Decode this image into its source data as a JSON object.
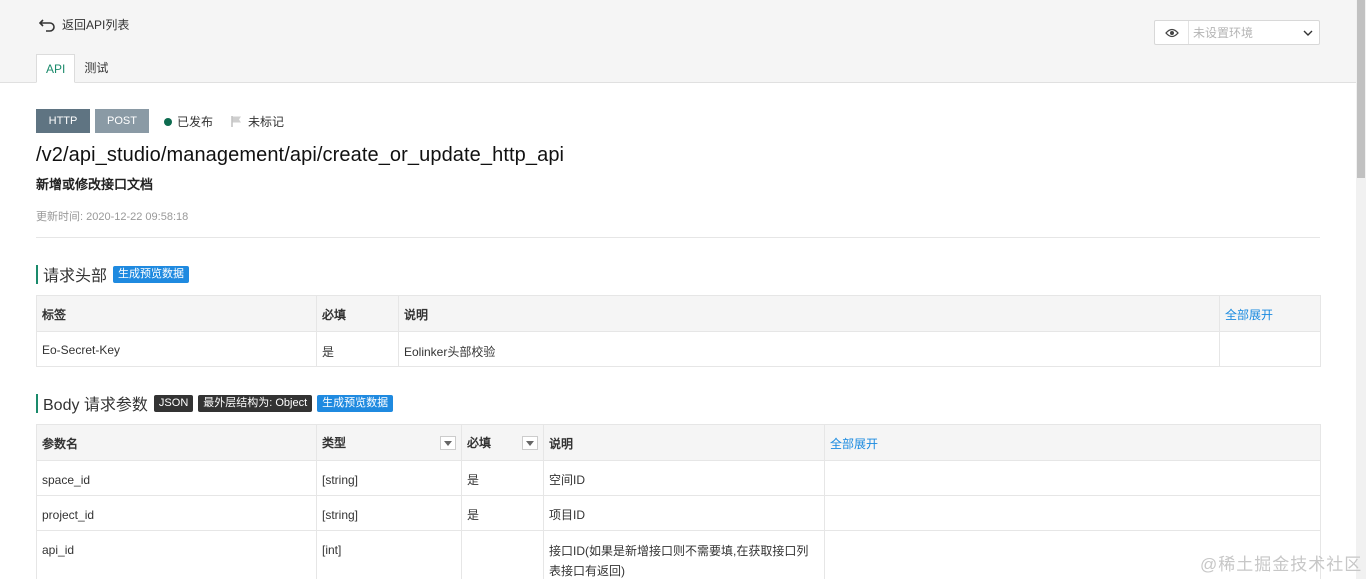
{
  "header": {
    "back_label": "返回API列表",
    "env_placeholder": "未设置环境",
    "tabs": [
      {
        "label": "API",
        "active": true
      },
      {
        "label": "测试",
        "active": false
      }
    ]
  },
  "api": {
    "protocol": "HTTP",
    "method": "POST",
    "status": "已发布",
    "mark": "未标记",
    "url": "/v2/api_studio/management/api/create_or_update_http_api",
    "description": "新增或修改接口文档",
    "updated": "更新时间:   2020-12-22 09:58:18"
  },
  "request_headers": {
    "title": "请求头部",
    "generate_label": "生成预览数据",
    "columns": [
      "标签",
      "必填",
      "说明"
    ],
    "expand_all": "全部展开",
    "rows": [
      {
        "label": "Eo-Secret-Key",
        "required": "是",
        "description": "Eolinker头部校验"
      }
    ]
  },
  "body_params": {
    "title": "Body 请求参数",
    "json_tag": "JSON",
    "outer_structure": "最外层结构为: Object",
    "generate_label": "生成预览数据",
    "columns": [
      "参数名",
      "类型",
      "必填",
      "说明"
    ],
    "expand_all": "全部展开",
    "rows": [
      {
        "name": "space_id",
        "type": "[string]",
        "required": "是",
        "description": "空间ID"
      },
      {
        "name": "project_id",
        "type": "[string]",
        "required": "是",
        "description": "项目ID"
      },
      {
        "name": "api_id",
        "type": "[int]",
        "required": "",
        "description": "接口ID(如果是新增接口则不需要填,在获取接口列表接口有返回)"
      }
    ]
  },
  "watermark": "@稀土掘金技术社区",
  "colors": {
    "accent": "#1a8a6b",
    "link": "#1a8ae0",
    "badge_http": "#5f7482",
    "badge_post": "#8a9aa5",
    "status_dot": "#0d6b4f"
  }
}
